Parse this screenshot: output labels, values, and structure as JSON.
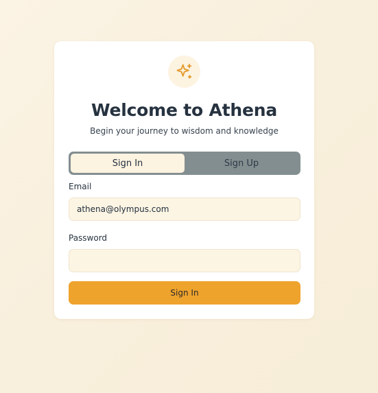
{
  "header": {
    "logo_icon": "sparkles-icon",
    "title": "Welcome to Athena",
    "subtitle": "Begin your journey to wisdom and knowledge"
  },
  "tabs": [
    {
      "label": "Sign In",
      "active": true
    },
    {
      "label": "Sign Up",
      "active": false
    }
  ],
  "form": {
    "email_label": "Email",
    "email_value": "athena@olympus.com",
    "password_label": "Password",
    "password_value": "",
    "submit_label": "Sign In"
  },
  "colors": {
    "accent": "#eea32d",
    "tab_bar": "#838e90",
    "input_bg": "#fdf5e3"
  }
}
